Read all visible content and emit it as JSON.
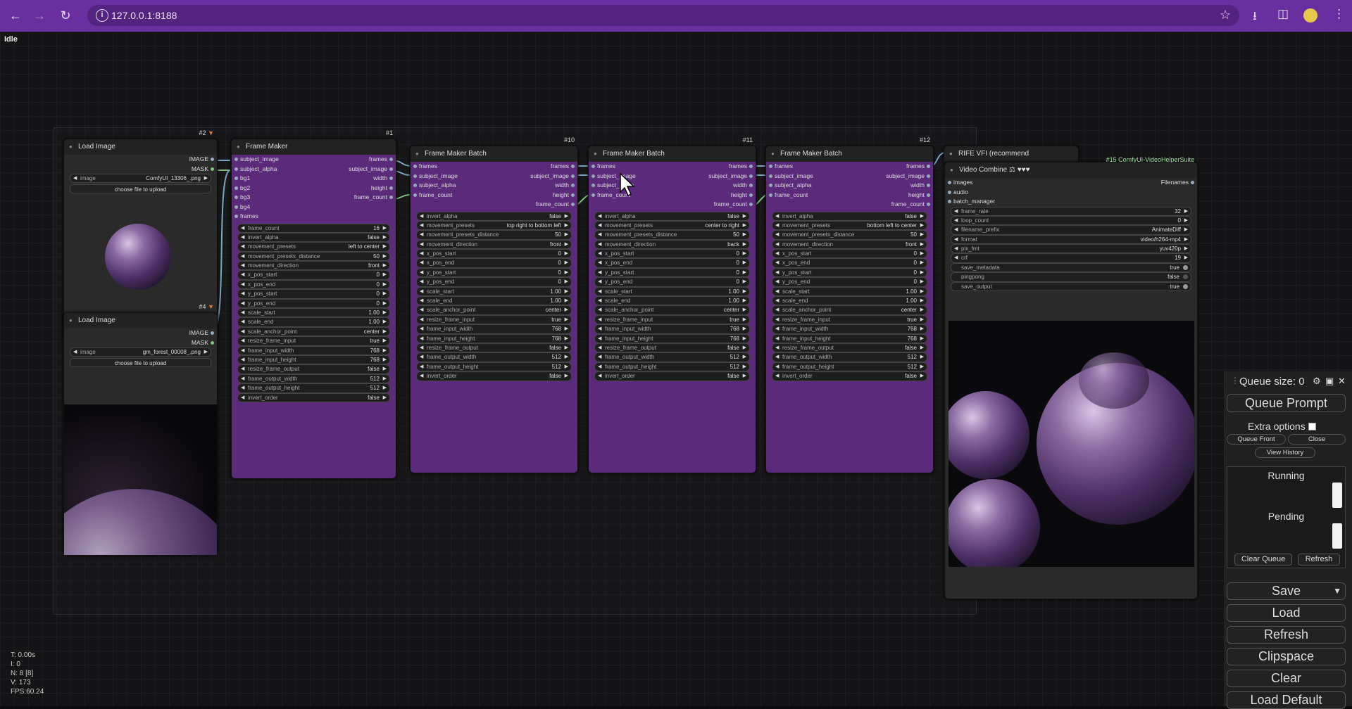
{
  "browser": {
    "url": "127.0.0.1:8188"
  },
  "canvas": {
    "status": "Idle",
    "stats": [
      "T: 0.00s",
      "I: 0",
      "N: 8 [8]",
      "V: 173",
      "FPS:60.24"
    ]
  },
  "nodes": {
    "load_image_2": {
      "title": "Load Image",
      "id": "#2",
      "outputs": [
        "IMAGE",
        "MASK"
      ],
      "image_label": "image",
      "image_value": "ComfyUI_13306_.png",
      "upload_label": "choose file to upload"
    },
    "load_image_4": {
      "title": "Load Image",
      "id": "#4",
      "outputs": [
        "IMAGE",
        "MASK"
      ],
      "image_label": "image",
      "image_value": "gm_forest_00008_.png",
      "upload_label": "choose file to upload"
    },
    "frame_maker_1": {
      "title": "Frame Maker",
      "id": "#1",
      "inputs": [
        "subject_image",
        "subject_alpha",
        "bg1",
        "bg2",
        "bg3",
        "bg4",
        "frames"
      ],
      "outputs": [
        "frames",
        "subject_image",
        "width",
        "height",
        "frame_count"
      ],
      "widgets": [
        {
          "label": "frame_count",
          "value": "16"
        },
        {
          "label": "invert_alpha",
          "value": "false"
        },
        {
          "label": "movement_presets",
          "value": "left to center"
        },
        {
          "label": "movement_presets_distance",
          "value": "50"
        },
        {
          "label": "movement_direction",
          "value": "front"
        },
        {
          "label": "x_pos_start",
          "value": "0"
        },
        {
          "label": "x_pos_end",
          "value": "0"
        },
        {
          "label": "y_pos_start",
          "value": "0"
        },
        {
          "label": "y_pos_end",
          "value": "0"
        },
        {
          "label": "scale_start",
          "value": "1.00"
        },
        {
          "label": "scale_end",
          "value": "1.00"
        },
        {
          "label": "scale_anchor_point",
          "value": "center"
        },
        {
          "label": "resize_frame_input",
          "value": "true"
        },
        {
          "label": "frame_input_width",
          "value": "768"
        },
        {
          "label": "frame_input_height",
          "value": "768"
        },
        {
          "label": "resize_frame_output",
          "value": "false"
        },
        {
          "label": "frame_output_width",
          "value": "512"
        },
        {
          "label": "frame_output_height",
          "value": "512"
        },
        {
          "label": "invert_order",
          "value": "false"
        }
      ]
    },
    "batch_10": {
      "title": "Frame Maker Batch",
      "id": "#10",
      "inputs": [
        "frames",
        "subject_image",
        "subject_alpha",
        "frame_count"
      ],
      "outputs": [
        "frames",
        "subject_image",
        "width",
        "height",
        "frame_count"
      ],
      "widgets": [
        {
          "label": "invert_alpha",
          "value": "false"
        },
        {
          "label": "movement_presets",
          "value": "top right to bottom left"
        },
        {
          "label": "movement_presets_distance",
          "value": "50"
        },
        {
          "label": "movement_direction",
          "value": "front"
        },
        {
          "label": "x_pos_start",
          "value": "0"
        },
        {
          "label": "x_pos_end",
          "value": "0"
        },
        {
          "label": "y_pos_start",
          "value": "0"
        },
        {
          "label": "y_pos_end",
          "value": "0"
        },
        {
          "label": "scale_start",
          "value": "1.00"
        },
        {
          "label": "scale_end",
          "value": "1.00"
        },
        {
          "label": "scale_anchor_point",
          "value": "center"
        },
        {
          "label": "resize_frame_input",
          "value": "true"
        },
        {
          "label": "frame_input_width",
          "value": "768"
        },
        {
          "label": "frame_input_height",
          "value": "768"
        },
        {
          "label": "resize_frame_output",
          "value": "false"
        },
        {
          "label": "frame_output_width",
          "value": "512"
        },
        {
          "label": "frame_output_height",
          "value": "512"
        },
        {
          "label": "invert_order",
          "value": "false"
        }
      ]
    },
    "batch_11": {
      "title": "Frame Maker Batch",
      "id": "#11",
      "inputs": [
        "frames",
        "subject_image",
        "subject_alpha",
        "frame_count"
      ],
      "outputs": [
        "frames",
        "subject_image",
        "width",
        "height",
        "frame_count"
      ],
      "widgets": [
        {
          "label": "invert_alpha",
          "value": "false"
        },
        {
          "label": "movement_presets",
          "value": "center to right"
        },
        {
          "label": "movement_presets_distance",
          "value": "50"
        },
        {
          "label": "movement_direction",
          "value": "back"
        },
        {
          "label": "x_pos_start",
          "value": "0"
        },
        {
          "label": "x_pos_end",
          "value": "0"
        },
        {
          "label": "y_pos_start",
          "value": "0"
        },
        {
          "label": "y_pos_end",
          "value": "0"
        },
        {
          "label": "scale_start",
          "value": "1.00"
        },
        {
          "label": "scale_end",
          "value": "1.00"
        },
        {
          "label": "scale_anchor_point",
          "value": "center"
        },
        {
          "label": "resize_frame_input",
          "value": "true"
        },
        {
          "label": "frame_input_width",
          "value": "768"
        },
        {
          "label": "frame_input_height",
          "value": "768"
        },
        {
          "label": "resize_frame_output",
          "value": "false"
        },
        {
          "label": "frame_output_width",
          "value": "512"
        },
        {
          "label": "frame_output_height",
          "value": "512"
        },
        {
          "label": "invert_order",
          "value": "false"
        }
      ]
    },
    "batch_12": {
      "title": "Frame Maker Batch",
      "id": "#12",
      "inputs": [
        "frames",
        "subject_image",
        "subject_alpha",
        "frame_count"
      ],
      "outputs": [
        "frames",
        "subject_image",
        "width",
        "height",
        "frame_count"
      ],
      "widgets": [
        {
          "label": "invert_alpha",
          "value": "false"
        },
        {
          "label": "movement_presets",
          "value": "bottom left to center"
        },
        {
          "label": "movement_presets_distance",
          "value": "50"
        },
        {
          "label": "movement_direction",
          "value": "front"
        },
        {
          "label": "x_pos_start",
          "value": "0"
        },
        {
          "label": "x_pos_end",
          "value": "0"
        },
        {
          "label": "y_pos_start",
          "value": "0"
        },
        {
          "label": "y_pos_end",
          "value": "0"
        },
        {
          "label": "scale_start",
          "value": "1.00"
        },
        {
          "label": "scale_end",
          "value": "1.00"
        },
        {
          "label": "scale_anchor_point",
          "value": "center"
        },
        {
          "label": "resize_frame_input",
          "value": "true"
        },
        {
          "label": "frame_input_width",
          "value": "768"
        },
        {
          "label": "frame_input_height",
          "value": "768"
        },
        {
          "label": "resize_frame_output",
          "value": "false"
        },
        {
          "label": "frame_output_width",
          "value": "512"
        },
        {
          "label": "frame_output_height",
          "value": "512"
        },
        {
          "label": "invert_order",
          "value": "false"
        }
      ]
    },
    "rife": {
      "title": "RIFE VFI (recommend"
    },
    "video_combine": {
      "title": "Video Combine",
      "title_extra": "⚖ ♥♥♥",
      "id": "#15 ComfyUI-VideoHelperSuite",
      "inputs": [
        "images",
        "audio",
        "batch_manager"
      ],
      "outputs": [
        "Filenames"
      ],
      "widgets": [
        {
          "label": "frame_rate",
          "value": "32"
        },
        {
          "label": "loop_count",
          "value": "0"
        },
        {
          "label": "filename_prefix",
          "value": "AnimateDiff"
        },
        {
          "label": "format",
          "value": "video/h264-mp4"
        },
        {
          "label": "pix_fmt",
          "value": "yuv420p"
        },
        {
          "label": "crf",
          "value": "19"
        },
        {
          "label": "save_metadata",
          "value": "true"
        },
        {
          "label": "pingpong",
          "value": "false"
        },
        {
          "label": "save_output",
          "value": "true"
        }
      ]
    }
  },
  "queue": {
    "size_label": "Queue size: 0",
    "queue_prompt": "Queue Prompt",
    "extra_options": "Extra options",
    "queue_front": "Queue Front",
    "close": "Close",
    "view_history": "View History",
    "running": "Running",
    "pending": "Pending",
    "clear_queue": "Clear Queue",
    "refresh_small": "Refresh",
    "save": "Save",
    "load": "Load",
    "refresh": "Refresh",
    "clipspace": "Clipspace",
    "clear": "Clear",
    "load_default": "Load Default"
  },
  "colors": {
    "browser_chrome": "#6a2f9e",
    "node_purple": "#5b2a7a",
    "canvas_bg": "#141416"
  }
}
